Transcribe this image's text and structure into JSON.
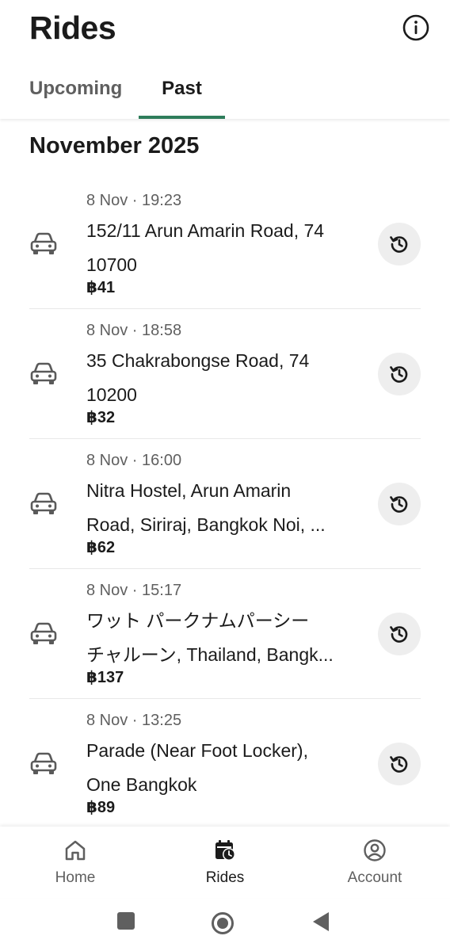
{
  "header": {
    "title": "Rides",
    "info_icon": "info-icon"
  },
  "tabs": [
    {
      "label": "Upcoming",
      "active": false
    },
    {
      "label": "Past",
      "active": true
    }
  ],
  "accent_color": "#2e7d5b",
  "section_title": "November 2025",
  "rides": [
    {
      "time": "8 Nov · 19:23",
      "line1": "152/11 Arun Amarin Road, 74",
      "line2": "10700",
      "price": "฿41"
    },
    {
      "time": "8 Nov · 18:58",
      "line1": "35 Chakrabongse Road, 74",
      "line2": "10200",
      "price": "฿32"
    },
    {
      "time": "8 Nov · 16:00",
      "line1": "Nitra Hostel, Arun Amarin",
      "line2": "Road, Siriraj, Bangkok Noi, ...",
      "price": "฿62"
    },
    {
      "time": "8 Nov · 15:17",
      "line1": "ワット パークナムパーシー",
      "line2": "チャルーン, Thailand, Bangk...",
      "price": "฿137"
    },
    {
      "time": "8 Nov · 13:25",
      "line1": "Parade (Near Foot Locker),",
      "line2": "One Bangkok",
      "price": "฿89"
    }
  ],
  "bottom_nav": [
    {
      "label": "Home",
      "icon": "home-icon",
      "active": false
    },
    {
      "label": "Rides",
      "icon": "calendar-clock-icon",
      "active": true
    },
    {
      "label": "Account",
      "icon": "account-icon",
      "active": false
    }
  ],
  "system_nav": [
    "square-icon",
    "circle-icon",
    "back-triangle-icon"
  ]
}
